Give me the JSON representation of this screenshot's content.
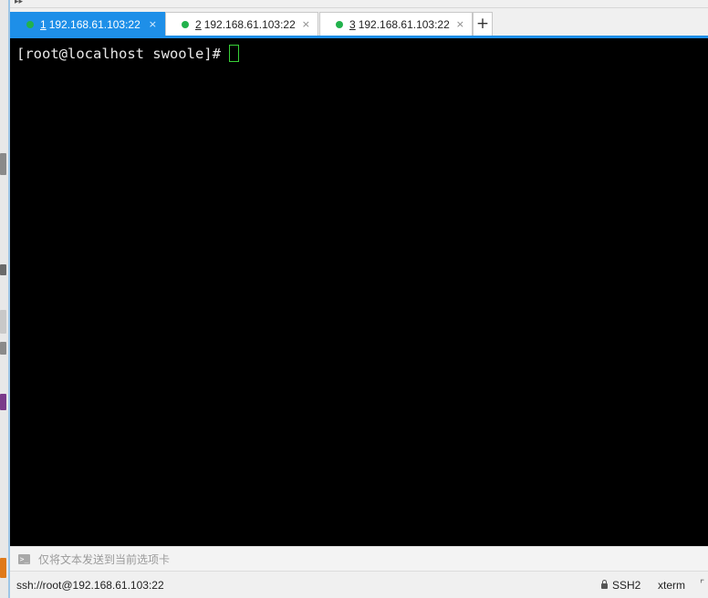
{
  "tabs": [
    {
      "number": "1",
      "label": "192.168.61.103:22",
      "active": true
    },
    {
      "number": "2",
      "label": "192.168.61.103:22",
      "active": false
    },
    {
      "number": "3",
      "label": "192.168.61.103:22",
      "active": false
    }
  ],
  "tab_close_glyph": "×",
  "new_tab_glyph": "+",
  "terminal": {
    "prompt": "[root@localhost swoole]#"
  },
  "compose": {
    "placeholder": "仅将文本发送到当前选项卡"
  },
  "status": {
    "connection": "ssh://root@192.168.61.103:22",
    "protocol": "SSH2",
    "terminal_type": "xterm"
  },
  "colors": {
    "accent": "#1e8fe8",
    "connected_dot": "#22b24c",
    "terminal_bg": "#000000",
    "cursor": "#38d038"
  }
}
